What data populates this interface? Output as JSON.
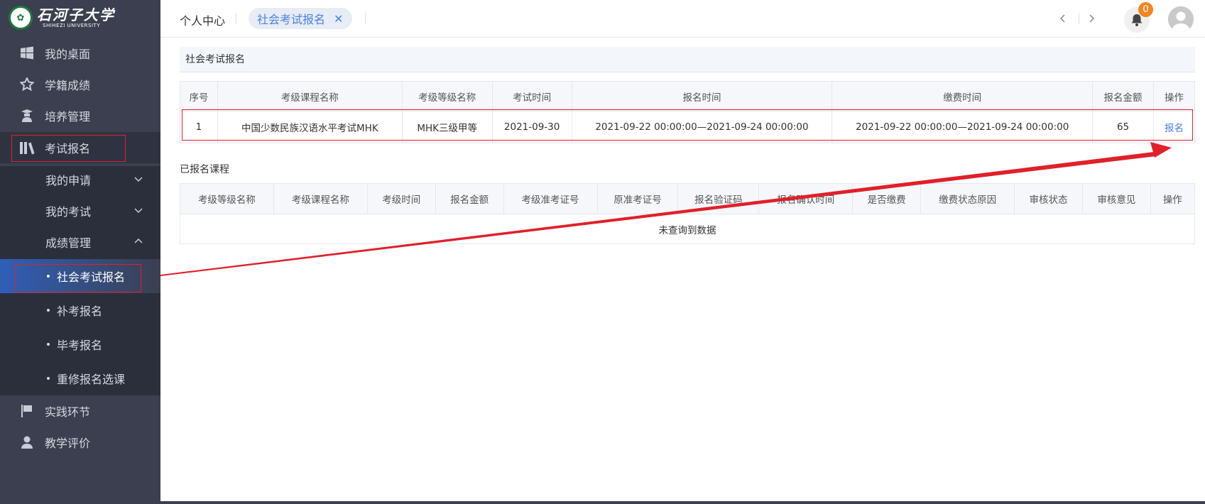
{
  "brand": {
    "name_cn": "石河子大学",
    "name_en": "SHIHEZI UNIVERSITY"
  },
  "sidebar": {
    "items": [
      {
        "label": "我的桌面",
        "icon": "windows-icon"
      },
      {
        "label": "学籍成绩",
        "icon": "star-icon"
      },
      {
        "label": "培养管理",
        "icon": "graduate-icon"
      },
      {
        "label": "考试报名",
        "icon": "books-icon"
      },
      {
        "label": "实践环节",
        "icon": "flag-icon"
      },
      {
        "label": "教学评价",
        "icon": "user-icon"
      }
    ],
    "sub_items": [
      {
        "label": "我的申请",
        "icon": "chevron-down-icon"
      },
      {
        "label": "我的考试",
        "icon": "chevron-down-icon"
      },
      {
        "label": "成绩管理",
        "icon": "chevron-up-icon"
      }
    ],
    "leaves": [
      {
        "label": "社会考试报名"
      },
      {
        "label": "补考报名"
      },
      {
        "label": "毕考报名"
      },
      {
        "label": "重修报名选课"
      }
    ]
  },
  "topbar": {
    "crumb": "个人中心",
    "active_tab": "社会考试报名",
    "notification_count": "0"
  },
  "main": {
    "section_title": "社会考试报名",
    "table1": {
      "headers": [
        "序号",
        "考级课程名称",
        "考级等级名称",
        "考试时间",
        "报名时间",
        "缴费时间",
        "报名金额",
        "操作"
      ],
      "rows": [
        [
          "1",
          "中国少数民族汉语水平考试MHK",
          "MHK三级甲等",
          "2021-09-30",
          "2021-09-22 00:00:00—2021-09-24 00:00:00",
          "2021-09-22 00:00:00—2021-09-24 00:00:00",
          "65",
          "报名"
        ]
      ]
    },
    "registered_title": "已报名课程",
    "table2": {
      "headers": [
        "考级等级名称",
        "考级课程名称",
        "考级时间",
        "报名金额",
        "考级准考证号",
        "原准考证号",
        "报名验证码",
        "报名确认时间",
        "是否缴费",
        "缴费状态原因",
        "审核状态",
        "审核意见",
        "操作"
      ],
      "empty": "未查询到数据"
    }
  },
  "colors": {
    "sidebar_bg": "#3b3f4f",
    "accent": "#4a7fe6",
    "highlight_red": "#e0202a",
    "badge": "#f0871f"
  }
}
